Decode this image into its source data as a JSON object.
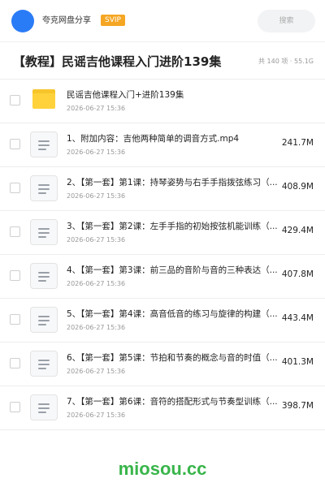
{
  "header": {
    "owner_name": "夸克网盘分享",
    "svip_label": "SVIP",
    "search_placeholder": "搜索"
  },
  "title_row": {
    "title": "【教程】民谣吉他课程入门进阶139集",
    "meta": "共 140 项 · 55.1G"
  },
  "files": [
    {
      "type": "folder",
      "name": "民谣吉他课程入门+进阶139集",
      "time": "2026-06-27 15:36",
      "size": ""
    },
    {
      "type": "file",
      "name": "1、附加内容：吉他两种简单的调音方式.mp4",
      "time": "2026-06-27 15:36",
      "size": "241.7M"
    },
    {
      "type": "file",
      "name": "2、【第一套】第1课：持琴姿势与右手手指拨弦练习（...",
      "time": "2026-06-27 15:36",
      "size": "408.9M"
    },
    {
      "type": "file",
      "name": "3、【第一套】第2课：左手手指的初始按弦机能训练（...",
      "time": "2026-06-27 15:36",
      "size": "429.4M"
    },
    {
      "type": "file",
      "name": "4、【第一套】第3课：前三品的音阶与音的三种表达（...",
      "time": "2026-06-27 15:36",
      "size": "407.8M"
    },
    {
      "type": "file",
      "name": "5、【第一套】第4课：高音低音的练习与旋律的构建（...",
      "time": "2026-06-27 15:36",
      "size": "443.4M"
    },
    {
      "type": "file",
      "name": "6、【第一套】第5课：节拍和节奏的概念与音的时值（...",
      "time": "2026-06-27 15:36",
      "size": "401.3M"
    },
    {
      "type": "file",
      "name": "7、【第一套】第6课：音符的搭配形式与节奏型训练（...",
      "time": "2026-06-27 15:36",
      "size": "398.7M"
    }
  ],
  "watermark": "miosou.cc",
  "colors": {
    "avatar": "#2a7bf6",
    "svip": "#f5a623",
    "folder": "#ffd23b",
    "watermark": "#39b54a"
  },
  "icons": {
    "folder": "folder-icon",
    "file": "document-icon",
    "search": "search-icon"
  }
}
